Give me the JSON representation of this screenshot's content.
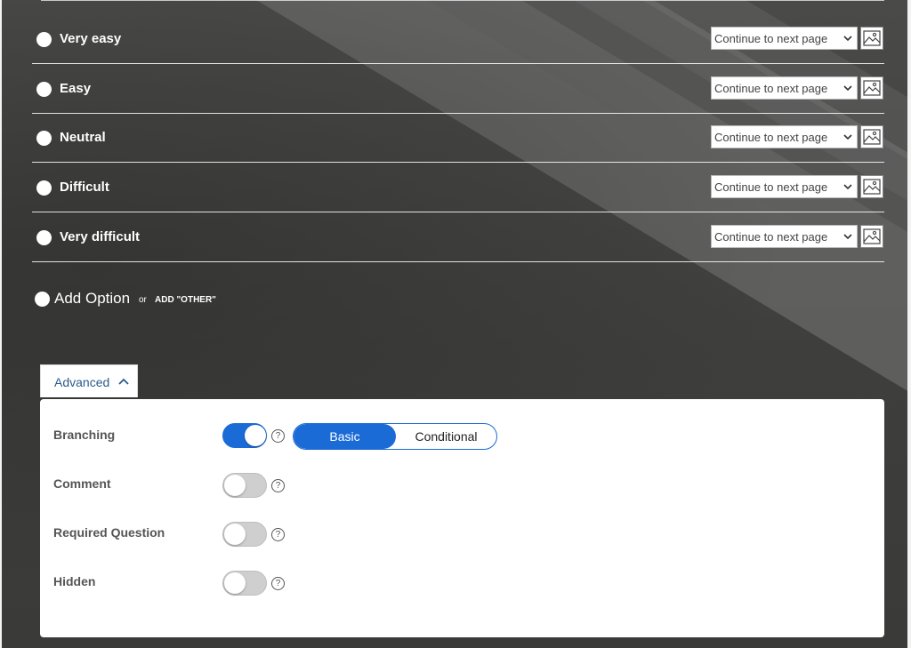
{
  "options": [
    {
      "label": "Very easy",
      "branch": "Continue to next page"
    },
    {
      "label": "Easy",
      "branch": "Continue to next page"
    },
    {
      "label": "Neutral",
      "branch": "Continue to next page"
    },
    {
      "label": "Difficult",
      "branch": "Continue to next page"
    },
    {
      "label": "Very difficult",
      "branch": "Continue to next page"
    }
  ],
  "add_option": {
    "label": "Add Option",
    "or": "or",
    "add_other": "ADD \"OTHER\""
  },
  "advanced": {
    "tab_label": "Advanced",
    "settings": {
      "branching": {
        "label": "Branching",
        "enabled": true,
        "help": "?"
      },
      "comment": {
        "label": "Comment",
        "enabled": false,
        "help": "?"
      },
      "required": {
        "label": "Required Question",
        "enabled": false,
        "help": "?"
      },
      "hidden": {
        "label": "Hidden",
        "enabled": false,
        "help": "?"
      }
    },
    "branching_mode": {
      "options": [
        "Basic",
        "Conditional"
      ],
      "selected": "Basic"
    }
  },
  "colors": {
    "accent": "#1a6bd6",
    "link": "#2c5a8c"
  },
  "icons": {
    "chevron": "chevron-down-icon",
    "image": "image-icon",
    "collapse": "chevron-up-icon"
  }
}
